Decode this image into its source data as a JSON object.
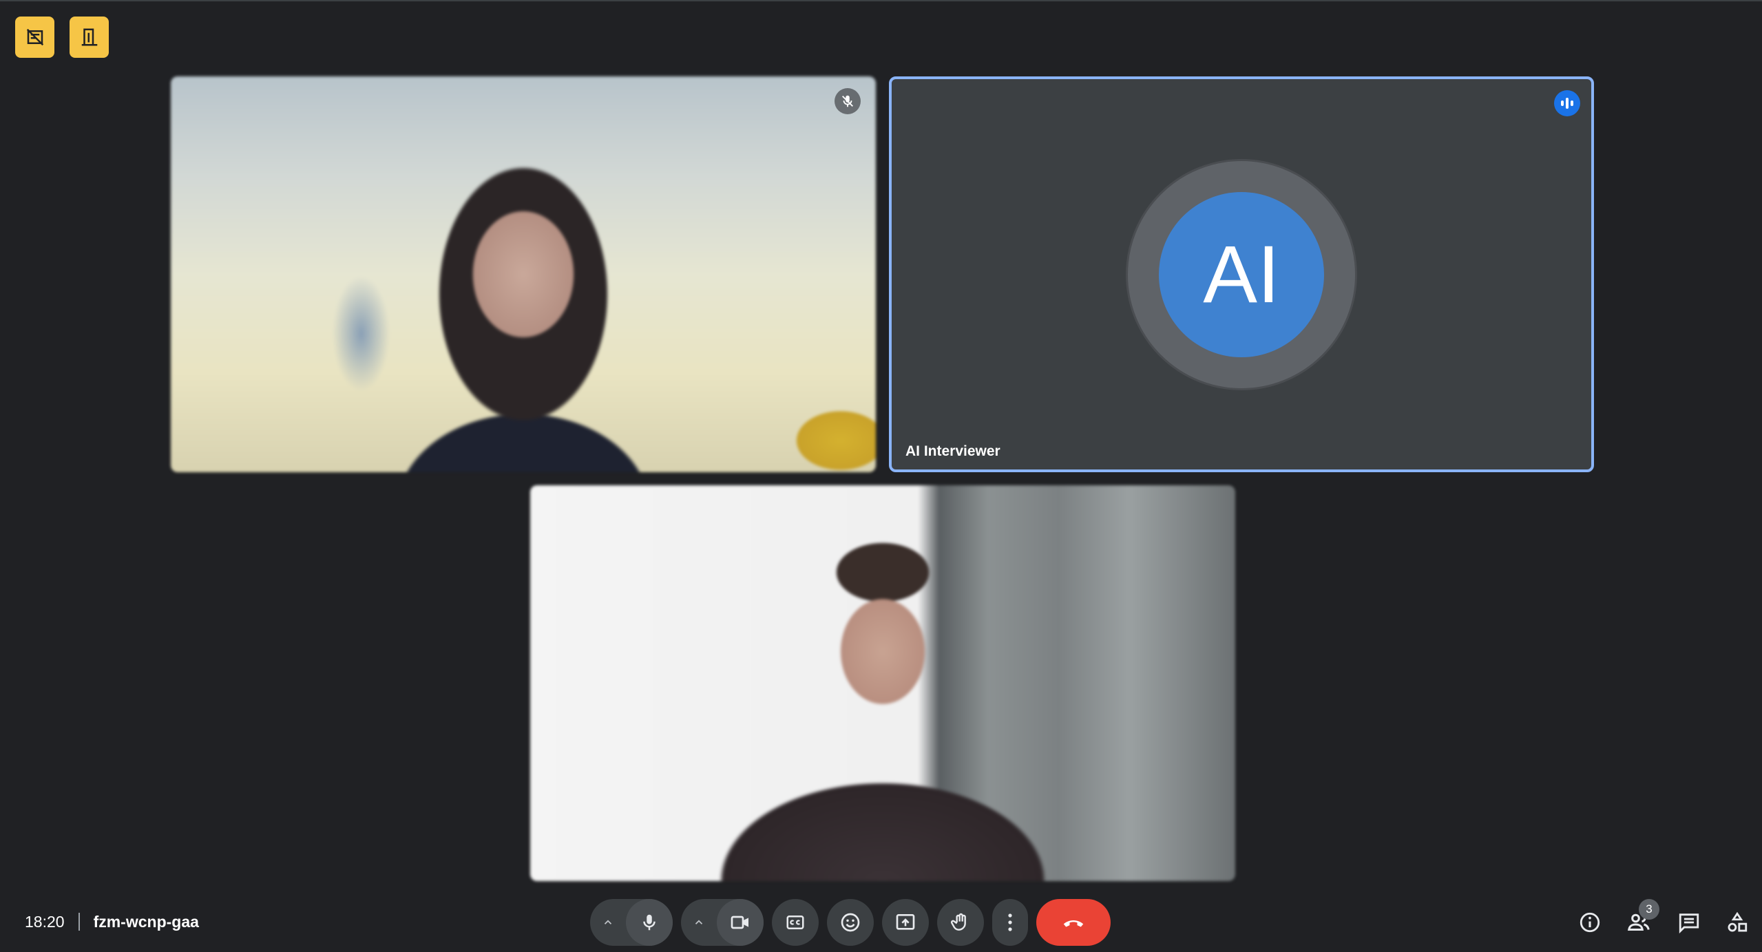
{
  "meeting": {
    "time": "18:20",
    "code": "fzm-wcnp-gaa"
  },
  "top_badges": [
    {
      "icon": "no-recording-icon"
    },
    {
      "icon": "door-exit-icon"
    }
  ],
  "tiles": [
    {
      "type": "video",
      "muted": true
    },
    {
      "type": "avatar",
      "name": "AI Interviewer",
      "initials": "AI",
      "speaking": true,
      "avatar_color": "#3f82d0",
      "highlight_color": "#8ab4f8"
    },
    {
      "type": "video",
      "muted": false
    }
  ],
  "controls": [
    {
      "icon": "chevron-up-icon"
    },
    {
      "icon": "microphone-icon"
    },
    {
      "icon": "chevron-up-icon"
    },
    {
      "icon": "camera-icon"
    },
    {
      "icon": "captions-icon"
    },
    {
      "icon": "emoji-icon"
    },
    {
      "icon": "present-screen-icon"
    },
    {
      "icon": "raise-hand-icon"
    },
    {
      "icon": "more-options-icon"
    },
    {
      "icon": "end-call-icon",
      "color": "#ea4335"
    }
  ],
  "right_panel": {
    "participant_count": "3",
    "icons": [
      "info-icon",
      "people-icon",
      "chat-icon",
      "activities-icon"
    ]
  }
}
